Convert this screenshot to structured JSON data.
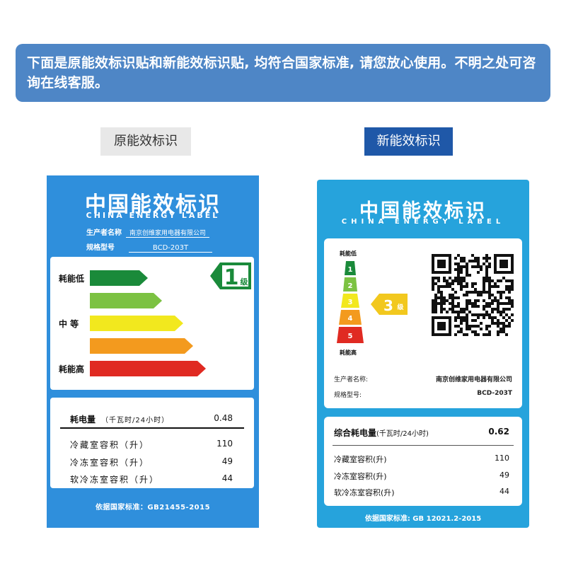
{
  "notice": "下面是原能效标识贴和新能效标识贴, 均符合国家标准, 请您放心使用。不明之处可咨询在线客服。",
  "captions": {
    "old": "原能效标识",
    "new": "新能效标识"
  },
  "old_label": {
    "title": "中国能效标识",
    "subtitle": "CHINA ENERGY LABEL",
    "manufacturer_label": "生产者名称",
    "manufacturer": "南京创维家用电器有限公司",
    "model_label": "规格型号",
    "model": "BCD-203T",
    "scale_low": "耗能低",
    "scale_mid": "中 等",
    "scale_high": "耗能高",
    "grade": "1",
    "grade_suffix": "级",
    "grade_colors": [
      "#1a8a3a",
      "#7cc242",
      "#f2e81e",
      "#f39a1e",
      "#e02a22"
    ],
    "rows": [
      {
        "label": "耗电量",
        "unit": "（千瓦时/24小时）",
        "value": "0.48"
      },
      {
        "label": "冷藏室容积（升）",
        "value": "110"
      },
      {
        "label": "冷冻室容积（升）",
        "value": "49"
      },
      {
        "label": "软冷冻室容积（升）",
        "value": "44"
      }
    ],
    "footer": "依据国家标准：GB21455-2015"
  },
  "new_label": {
    "title": "中国能效标识",
    "subtitle": "CHINA ENERGY LABEL",
    "scale_low": "耗能低",
    "scale_high": "耗能高",
    "levels": [
      "1",
      "2",
      "3",
      "4",
      "5"
    ],
    "level_colors": [
      "#1a8a3a",
      "#7cc242",
      "#f2e81e",
      "#f39a1e",
      "#e02a22"
    ],
    "grade": "3",
    "grade_suffix": "级",
    "manufacturer_label": "生产者名称:",
    "manufacturer": "南京创维家用电器有限公司",
    "model_label": "规格型号:",
    "model": "BCD-203T",
    "rows": [
      {
        "label": "综合耗电量",
        "unit": "(千瓦时/24小时)",
        "value": "0.62"
      },
      {
        "label": "冷藏室容积(升)",
        "value": "110"
      },
      {
        "label": "冷冻室容积(升)",
        "value": "49"
      },
      {
        "label": "软冷冻室容积(升)",
        "value": "44"
      }
    ],
    "footer": "依据国家标准: GB 12021.2-2015"
  }
}
